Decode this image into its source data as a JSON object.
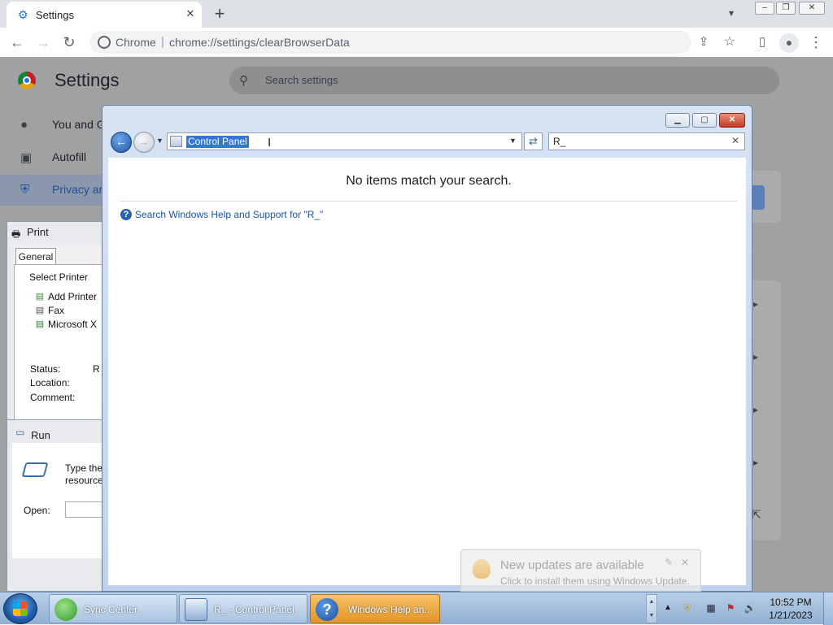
{
  "browser": {
    "tab_title": "Settings",
    "tab_close": "✕",
    "new_tab": "+",
    "omnibox_brand": "Chrome",
    "omnibox_sep": "|",
    "omnibox_url": "chrome://settings/clearBrowserData"
  },
  "settings": {
    "title": "Settings",
    "search_placeholder": "Search settings",
    "sidebar": [
      {
        "label": "You and G",
        "icon": "person-icon"
      },
      {
        "label": "Autofill",
        "icon": "clipboard-icon"
      },
      {
        "label": "Privacy an",
        "icon": "shield-icon"
      }
    ]
  },
  "print_dialog": {
    "title": "Print",
    "tab": "General",
    "group": "Select Printer",
    "printers": [
      "Add Printer",
      "Fax",
      "Microsoft X"
    ],
    "status_label": "Status:",
    "status_value": "R",
    "location_label": "Location:",
    "comment_label": "Comment:"
  },
  "run_dialog": {
    "title": "Run",
    "desc_line1": "Type the",
    "desc_line2": "resource,",
    "open_label": "Open:"
  },
  "control_panel": {
    "address": "Control Panel",
    "search_value": "R_",
    "no_items": "No items match your search.",
    "help_link": "Search Windows Help and Support for \"R_\""
  },
  "notification": {
    "title": "New updates are available",
    "subtitle": "Click to install them using Windows Update."
  },
  "taskbar": {
    "items": [
      {
        "label": "Sync Center"
      },
      {
        "label": "R_ - Control Panel"
      },
      {
        "label": "Windows Help an..."
      }
    ],
    "time": "10:52 PM",
    "date": "1/21/2023"
  }
}
